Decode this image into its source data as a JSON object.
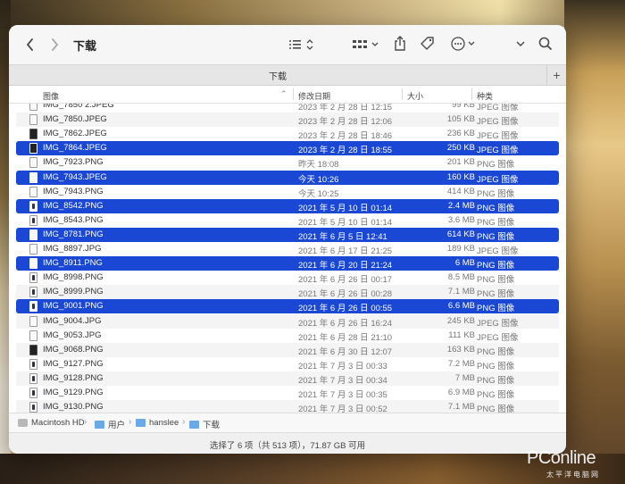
{
  "window": {
    "title": "下载",
    "tab_label": "下载"
  },
  "toolbar": {
    "back_icon": "chevron-left-icon",
    "forward_icon": "chevron-right-icon",
    "list_view_icon": "list-view-icon",
    "grid_view_icon": "grid-view-icon",
    "share_icon": "share-icon",
    "tag_icon": "tag-icon",
    "more_icon": "ellipsis-icon",
    "dropdown_icon": "chevron-down-icon",
    "search_icon": "search-icon",
    "new_tab_label": "+"
  },
  "columns": {
    "name": "图像",
    "date": "修改日期",
    "size": "大小",
    "kind": "种类"
  },
  "files": [
    {
      "name": "IMG_7850 2.JPEG",
      "date": "2023 年 2 月 28 日 12:15",
      "size": "99 KB",
      "kind": "JPEG 图像",
      "selected": false,
      "icon": "light"
    },
    {
      "name": "IMG_7850.JPEG",
      "date": "2023 年 2 月 28 日 12:06",
      "size": "105 KB",
      "kind": "JPEG 图像",
      "selected": false,
      "icon": "light"
    },
    {
      "name": "IMG_7862.JPEG",
      "date": "2023 年 2 月 28 日 18:46",
      "size": "236 KB",
      "kind": "JPEG 图像",
      "selected": false,
      "icon": "dark"
    },
    {
      "name": "IMG_7864.JPEG",
      "date": "2023 年 2 月 28 日 18:55",
      "size": "250 KB",
      "kind": "JPEG 图像",
      "selected": true,
      "icon": "dark"
    },
    {
      "name": "IMG_7923.PNG",
      "date": "昨天 18:08",
      "size": "201 KB",
      "kind": "PNG 图像",
      "selected": false,
      "icon": "light"
    },
    {
      "name": "IMG_7943.JPEG",
      "date": "今天 10:26",
      "size": "160 KB",
      "kind": "JPEG 图像",
      "selected": true,
      "icon": "light"
    },
    {
      "name": "IMG_7943.PNG",
      "date": "今天 10:25",
      "size": "414 KB",
      "kind": "PNG 图像",
      "selected": false,
      "icon": "light"
    },
    {
      "name": "IMG_8542.PNG",
      "date": "2021 年 5 月 10 日 01:14",
      "size": "2.4 MB",
      "kind": "PNG 图像",
      "selected": true,
      "icon": "phone"
    },
    {
      "name": "IMG_8543.PNG",
      "date": "2021 年 5 月 10 日 01:14",
      "size": "3.6 MB",
      "kind": "PNG 图像",
      "selected": false,
      "icon": "phone"
    },
    {
      "name": "IMG_8781.PNG",
      "date": "2021 年 6 月 5 日 12:41",
      "size": "614 KB",
      "kind": "PNG 图像",
      "selected": true,
      "icon": "light"
    },
    {
      "name": "IMG_8897.JPG",
      "date": "2021 年 6 月 17 日 21:25",
      "size": "189 KB",
      "kind": "JPEG 图像",
      "selected": false,
      "icon": "light"
    },
    {
      "name": "IMG_8911.PNG",
      "date": "2021 年 6 月 20 日 21:24",
      "size": "6 MB",
      "kind": "PNG 图像",
      "selected": true,
      "icon": "light"
    },
    {
      "name": "IMG_8998.PNG",
      "date": "2021 年 6 月 26 日 00:17",
      "size": "8.5 MB",
      "kind": "PNG 图像",
      "selected": false,
      "icon": "phone"
    },
    {
      "name": "IMG_8999.PNG",
      "date": "2021 年 6 月 26 日 00:28",
      "size": "7.1 MB",
      "kind": "PNG 图像",
      "selected": false,
      "icon": "phone"
    },
    {
      "name": "IMG_9001.PNG",
      "date": "2021 年 6 月 26 日 00:55",
      "size": "6.6 MB",
      "kind": "PNG 图像",
      "selected": true,
      "icon": "phone"
    },
    {
      "name": "IMG_9004.JPG",
      "date": "2021 年 6 月 26 日 16:24",
      "size": "245 KB",
      "kind": "JPEG 图像",
      "selected": false,
      "icon": "light"
    },
    {
      "name": "IMG_9053.JPG",
      "date": "2021 年 6 月 28 日 21:10",
      "size": "111 KB",
      "kind": "JPEG 图像",
      "selected": false,
      "icon": "light"
    },
    {
      "name": "IMG_9068.PNG",
      "date": "2021 年 6 月 30 日 12:07",
      "size": "163 KB",
      "kind": "PNG 图像",
      "selected": false,
      "icon": "dark"
    },
    {
      "name": "IMG_9127.PNG",
      "date": "2021 年 7 月 3 日 00:33",
      "size": "7.2 MB",
      "kind": "PNG 图像",
      "selected": false,
      "icon": "phone"
    },
    {
      "name": "IMG_9128.PNG",
      "date": "2021 年 7 月 3 日 00:34",
      "size": "7 MB",
      "kind": "PNG 图像",
      "selected": false,
      "icon": "phone"
    },
    {
      "name": "IMG_9129.PNG",
      "date": "2021 年 7 月 3 日 00:35",
      "size": "6.9 MB",
      "kind": "PNG 图像",
      "selected": false,
      "icon": "phone"
    },
    {
      "name": "IMG_9130.PNG",
      "date": "2021 年 7 月 3 日 00:52",
      "size": "7.1 MB",
      "kind": "PNG 图像",
      "selected": false,
      "icon": "phone"
    }
  ],
  "pathbar": [
    {
      "label": "Macintosh HD",
      "icon": "disk-icon"
    },
    {
      "label": "用户",
      "icon": "folder-icon"
    },
    {
      "label": "hanslee",
      "icon": "folder-icon"
    },
    {
      "label": "下载",
      "icon": "folder-icon"
    }
  ],
  "status": {
    "text": "选择了 6 项（共 513 项），71.87 GB 可用"
  },
  "watermark": {
    "brand": "PConline",
    "sub": "太平洋电脑网"
  },
  "colors": {
    "selection": "#1a47d4",
    "folder": "#6aa8e8"
  }
}
